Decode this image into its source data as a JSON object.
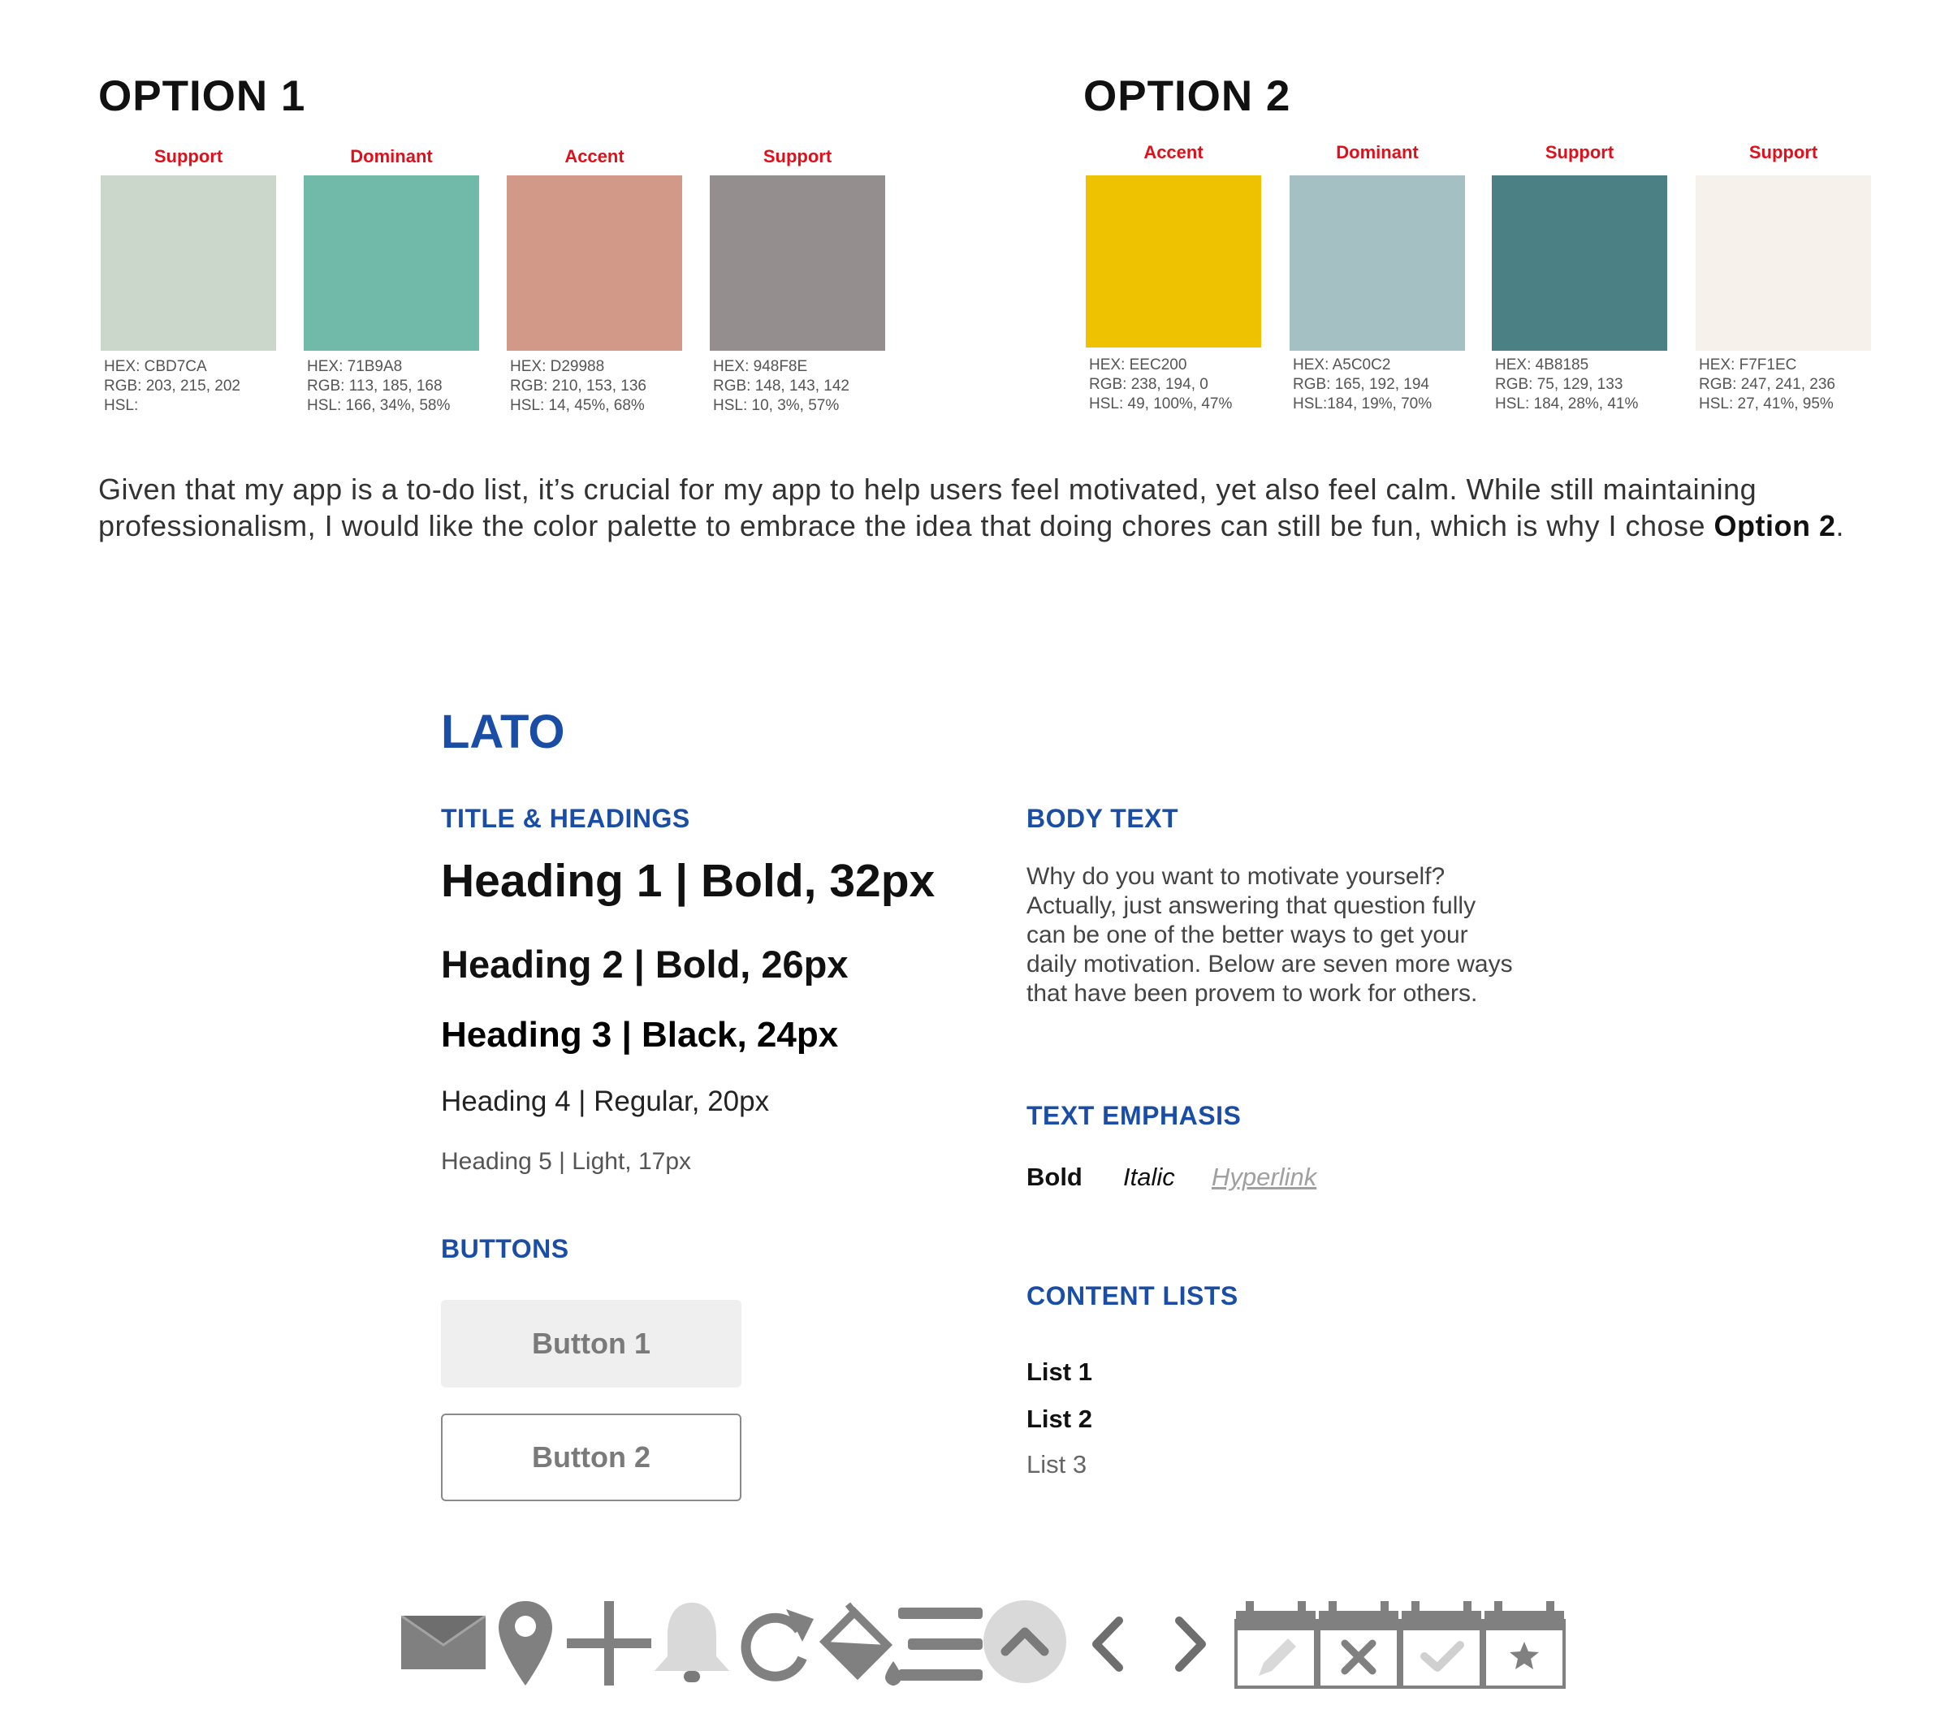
{
  "option1": {
    "title": "OPTION 1",
    "swatches": [
      {
        "role": "Support",
        "color": "#CBD7CA",
        "hex": "HEX: CBD7CA",
        "rgb": "RGB: 203, 215, 202",
        "hsl": "HSL:"
      },
      {
        "role": "Dominant",
        "color": "#71B9A8",
        "hex": "HEX: 71B9A8",
        "rgb": "RGB: 113, 185, 168",
        "hsl": "HSL: 166, 34%, 58%"
      },
      {
        "role": "Accent",
        "color": "#D29988",
        "hex": "HEX: D29988",
        "rgb": "RGB: 210, 153, 136",
        "hsl": "HSL: 14, 45%, 68%"
      },
      {
        "role": "Support",
        "color": "#948F8E",
        "hex": "HEX: 948F8E",
        "rgb": "RGB: 148, 143, 142",
        "hsl": "HSL: 10, 3%, 57%"
      }
    ]
  },
  "option2": {
    "title": "OPTION 2",
    "swatches": [
      {
        "role": "Accent",
        "color": "#EEC200",
        "hex": "HEX: EEC200",
        "rgb": "RGB: 238, 194, 0",
        "hsl": "HSL: 49, 100%, 47%"
      },
      {
        "role": "Dominant",
        "color": "#A5C0C2",
        "hex": "HEX: A5C0C2",
        "rgb": "RGB: 165, 192, 194",
        "hsl": "HSL:184, 19%, 70%"
      },
      {
        "role": "Support",
        "color": "#4B8185",
        "hex": "HEX: 4B8185",
        "rgb": "RGB: 75, 129, 133",
        "hsl": "HSL: 184, 28%, 41%"
      },
      {
        "role": "Support",
        "color": "#F7F1EC",
        "hex": "HEX: F7F1EC",
        "rgb": "RGB: 247, 241, 236",
        "hsl": "HSL: 27, 41%, 95%"
      }
    ]
  },
  "rationale": {
    "text": "Given that my app is a to-do list, it’s crucial for my app to help users feel motivated, yet also feel calm. While still maintaining professionalism, I would like the color palette to embrace the idea that doing chores can still be fun, which is why I chose ",
    "bold": "Option 2",
    "end": "."
  },
  "typography": {
    "font_name": "LATO",
    "headings_title": "TITLE & HEADINGS",
    "h1": "Heading 1 | Bold, 32px",
    "h2": "Heading 2 | Bold, 26px",
    "h3": "Heading 3 | Black, 24px",
    "h4": "Heading 4 | Regular, 20px",
    "h5": "Heading 5 | Light, 17px",
    "buttons_title": "BUTTONS",
    "button1": "Button 1",
    "button2": "Button 2",
    "body_title": "BODY TEXT",
    "body_text": "Why do you want to motivate yourself? Actually, just answering that question fully can be one of the better ways to get your daily motivation. Below are seven more ways that have been provem to work for others.",
    "emphasis_title": "TEXT EMPHASIS",
    "bold": "Bold",
    "italic": "Italic",
    "hyperlink": "Hyperlink",
    "lists_title": "CONTENT LISTS",
    "list1": "List 1",
    "list2": "List 2",
    "list3": "List 3"
  },
  "icons": [
    "mail-icon",
    "location-pin-icon",
    "plus-icon",
    "bell-icon",
    "refresh-icon",
    "paint-bucket-icon",
    "menu-icon",
    "chevron-up-icon",
    "chevron-left-icon",
    "chevron-right-icon",
    "calendar-edit-icon",
    "calendar-delete-icon",
    "calendar-check-icon",
    "calendar-star-icon"
  ],
  "colors": {
    "label_red": "#E0101B",
    "heading_blue": "#1A4EA6",
    "icon_gray": "#7F7F7F"
  }
}
